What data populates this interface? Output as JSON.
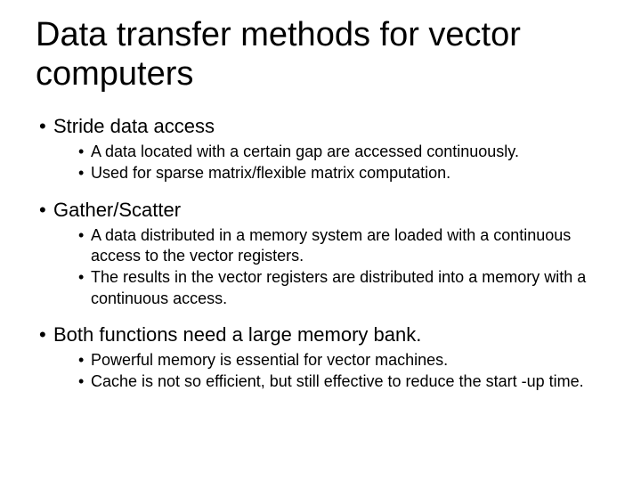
{
  "title": "Data transfer methods for vector computers",
  "bullets": [
    {
      "text": "Stride data access",
      "sub": [
        "A data located with a certain gap are accessed continuously.",
        "Used for sparse matrix/flexible matrix computation."
      ]
    },
    {
      "text": "Gather/Scatter",
      "sub": [
        "A data distributed in a memory system are loaded  with a continuous access to the vector registers.",
        "The results in the vector registers are distributed into a memory with a continuous access."
      ]
    },
    {
      "text": "Both functions need a large memory bank.",
      "sub": [
        "Powerful memory is essential for vector machines.",
        "Cache is not so efficient, but still effective to reduce the start -up time."
      ]
    }
  ]
}
